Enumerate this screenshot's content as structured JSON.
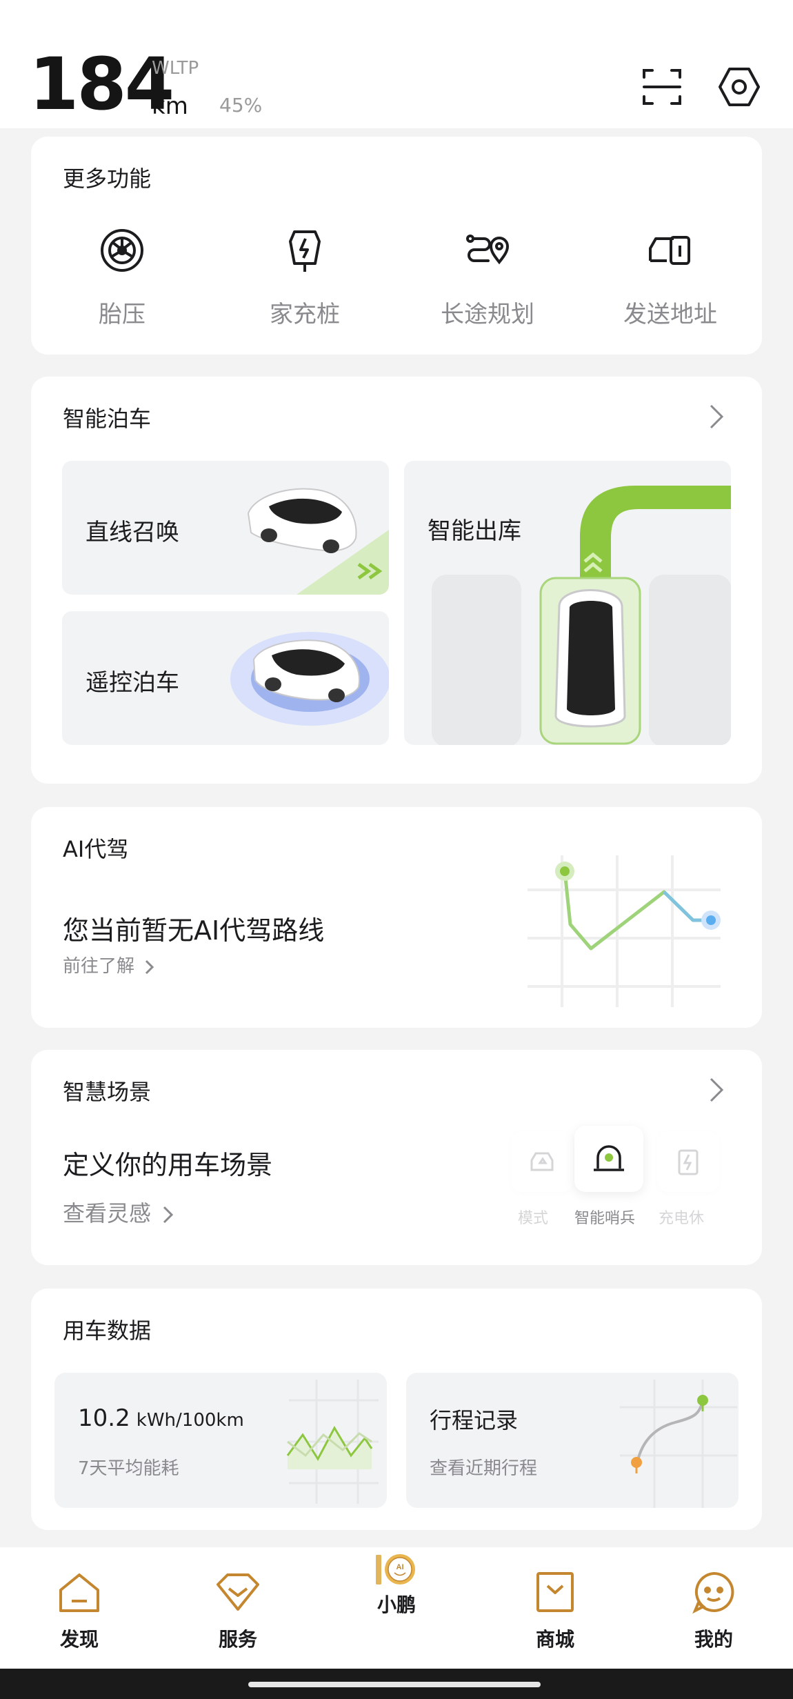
{
  "header": {
    "range_value": "184",
    "range_standard": "WLTP",
    "range_unit": "km",
    "battery_percent": "45%",
    "scan_icon": "scan-icon",
    "settings_icon": "settings-hex-icon"
  },
  "more_features": {
    "title": "更多功能",
    "items": [
      {
        "label": "胎压",
        "icon": "tire-icon"
      },
      {
        "label": "家充桩",
        "icon": "home-charger-icon"
      },
      {
        "label": "长途规划",
        "icon": "route-plan-icon"
      },
      {
        "label": "发送地址",
        "icon": "send-address-icon"
      }
    ]
  },
  "smart_parking": {
    "title": "智能泊车",
    "tiles": {
      "summon": "直线召唤",
      "remote": "遥控泊车",
      "exit": "智能出库"
    }
  },
  "ai_drive": {
    "title": "AI代驾",
    "message": "您当前暂无AI代驾路线",
    "link": "前往了解"
  },
  "scenes": {
    "title": "智慧场景",
    "headline": "定义你的用车场景",
    "link": "查看灵感",
    "chips": [
      "模式",
      "智能哨兵",
      "充电休"
    ]
  },
  "car_data": {
    "title": "用车数据",
    "energy_value": "10.2",
    "energy_unit": "kWh/100km",
    "energy_caption": "7天平均能耗",
    "trips_title": "行程记录",
    "trips_caption": "查看近期行程"
  },
  "tabs": [
    {
      "label": "发现",
      "icon": "home-icon"
    },
    {
      "label": "服务",
      "icon": "service-icon"
    },
    {
      "label": "小鹏",
      "icon": "xpeng-ai-icon",
      "badge": "AI"
    },
    {
      "label": "商城",
      "icon": "shop-bag-icon"
    },
    {
      "label": "我的",
      "icon": "profile-icon"
    }
  ],
  "colors": {
    "accent_green": "#8dc63f",
    "accent_gold": "#d7a43a",
    "route_blue": "#5aaef0"
  }
}
